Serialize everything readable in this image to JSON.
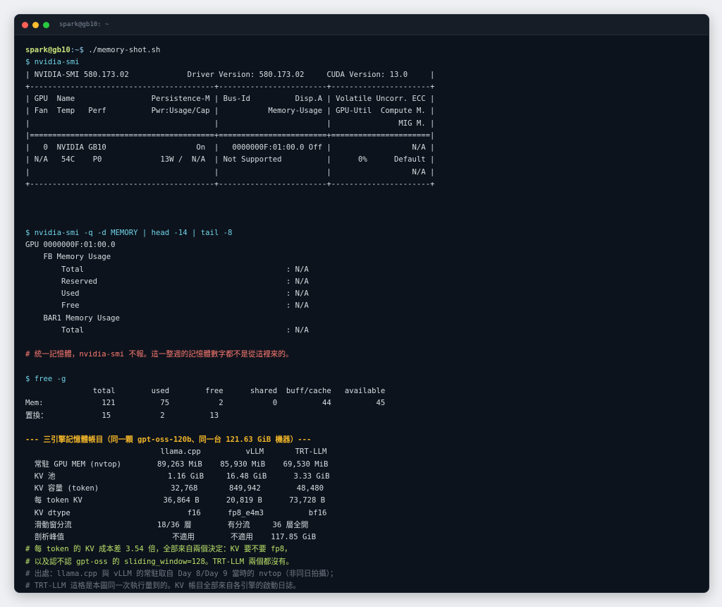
{
  "window": {
    "title": "spark@gb10: ~",
    "buttons": [
      "close",
      "minimize",
      "maximize"
    ]
  },
  "prompt": {
    "user_host": "spark@gb10",
    "path_symbol": ":~$ ",
    "command": "./memory-shot.sh"
  },
  "nvidia_smi": {
    "command": "$ nvidia-smi",
    "output": [
      "| NVIDIA-SMI 580.173.02             Driver Version: 580.173.02     CUDA Version: 13.0     |",
      "+-----------------------------------------+------------------------+----------------------+",
      "| GPU  Name                 Persistence-M | Bus-Id          Disp.A | Volatile Uncorr. ECC |",
      "| Fan  Temp   Perf          Pwr:Usage/Cap |           Memory-Usage | GPU-Util  Compute M. |",
      "|                                         |                        |               MIG M. |",
      "|=========================================+========================+======================|",
      "|   0  NVIDIA GB10                    On  |   0000000F:01:00.0 Off |                  N/A |",
      "| N/A   54C    P0             13W /  N/A  | Not Supported          |      0%      Default |",
      "|                                         |                        |                  N/A |",
      "+-----------------------------------------+------------------------+----------------------+"
    ]
  },
  "memory_query": {
    "command": "$ nvidia-smi -q -d MEMORY | head -14 | tail -8",
    "output": [
      "GPU 0000000F:01:00.0",
      "    FB Memory Usage",
      "        Total                                             : N/A",
      "        Reserved                                          : N/A",
      "        Used                                              : N/A",
      "        Free                                              : N/A",
      "    BAR1 Memory Usage",
      "        Total                                             : N/A"
    ]
  },
  "unified_memory_note": "# 統一記憶體，nvidia-smi 不報。這一整週的記憶體數字都不是從這裡來的。",
  "free": {
    "command": "$ free -g",
    "output": [
      "               total        used        free      shared  buff/cache   available",
      "Mem:             121          75           2           0          44          45",
      "置換：            15           2          13"
    ]
  },
  "engine_ledger": {
    "title": "--- 三引擎記憶體帳目（同一顆 gpt-oss-120b、同一台 121.63 GiB 機器）---",
    "output": [
      "                              llama.cpp          vLLM       TRT-LLM",
      "  常駐 GPU MEM (nvtop)        89,263 MiB    85,930 MiB    69,530 MiB",
      "  KV 池                         1.16 GiB     16.48 GiB      3.33 GiB",
      "  KV 容量 (token)                32,768       849,942        48,480",
      "  每 token KV                  36,864 B      20,819 B      73,728 B",
      "  KV dtype                          f16      fp8_e4m3          bf16",
      "  滑動窗分流                   18/36 層        有分流     36 層全開",
      "  剖析峰值                        不適用        不適用    117.85 GiB"
    ]
  },
  "conclusions": [
    "# 每 token 的 KV 成本差 3.54 倍，全部來自兩個決定：KV 要不要 fp8，",
    "# 以及認不認 gpt-oss 的 sliding_window=128。TRT-LLM 兩個都沒有。"
  ],
  "sources": [
    "# 出處：llama.cpp 與 vLLM 的常駐取自 Day 8/Day 9 當時的 nvtop（非同日拍攝）；",
    "# TRT-LLM 這格是本圖同一次執行量到的。KV 帳目全部來自各引擎的啟動日誌。"
  ]
}
